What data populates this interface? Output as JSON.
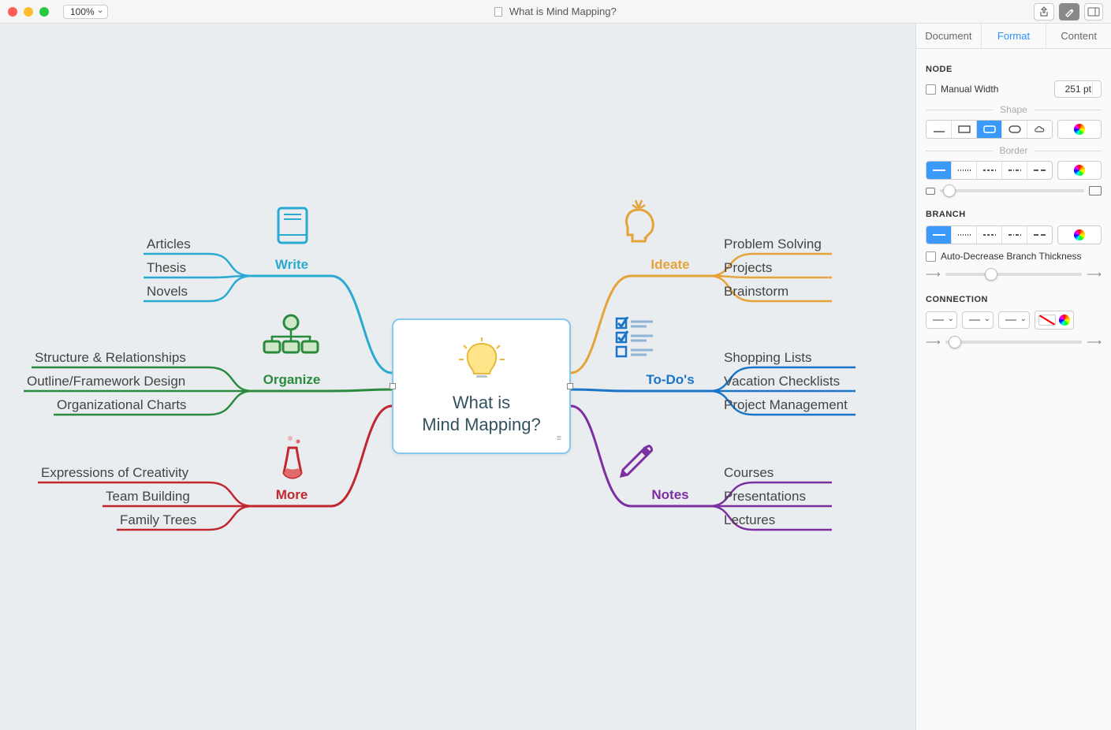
{
  "titlebar": {
    "zoom": "100%",
    "title": "What is Mind Mapping?"
  },
  "sidebar": {
    "tabs": {
      "document": "Document",
      "format": "Format",
      "content": "Content"
    },
    "node": {
      "header": "NODE",
      "manual_width": "Manual Width",
      "width_value": "251 pt",
      "shape_label": "Shape",
      "border_label": "Border"
    },
    "branch": {
      "header": "BRANCH",
      "auto_decrease": "Auto-Decrease Branch Thickness"
    },
    "connection": {
      "header": "CONNECTION"
    }
  },
  "mindmap": {
    "center": {
      "line1": "What is",
      "line2": "Mind Mapping?"
    },
    "write": {
      "label": "Write",
      "color": "#2aa9d2",
      "leaves": [
        "Articles",
        "Thesis",
        "Novels"
      ]
    },
    "organize": {
      "label": "Organize",
      "color": "#2a8a3e",
      "leaves": [
        "Structure & Relationships",
        "Outline/Framework Design",
        "Organizational Charts"
      ]
    },
    "more": {
      "label": "More",
      "color": "#c1272d",
      "leaves": [
        "Expressions of Creativity",
        "Team Building",
        "Family Trees"
      ]
    },
    "ideate": {
      "label": "Ideate",
      "color": "#e5a33a",
      "leaves": [
        "Problem Solving",
        "Projects",
        "Brainstorm"
      ]
    },
    "todos": {
      "label": "To-Do's",
      "color": "#1a74c7",
      "leaves": [
        "Shopping Lists",
        "Vacation Checklists",
        "Project Management"
      ]
    },
    "notes": {
      "label": "Notes",
      "color": "#7b2fa0",
      "leaves": [
        "Courses",
        "Presentations",
        "Lectures"
      ]
    }
  }
}
